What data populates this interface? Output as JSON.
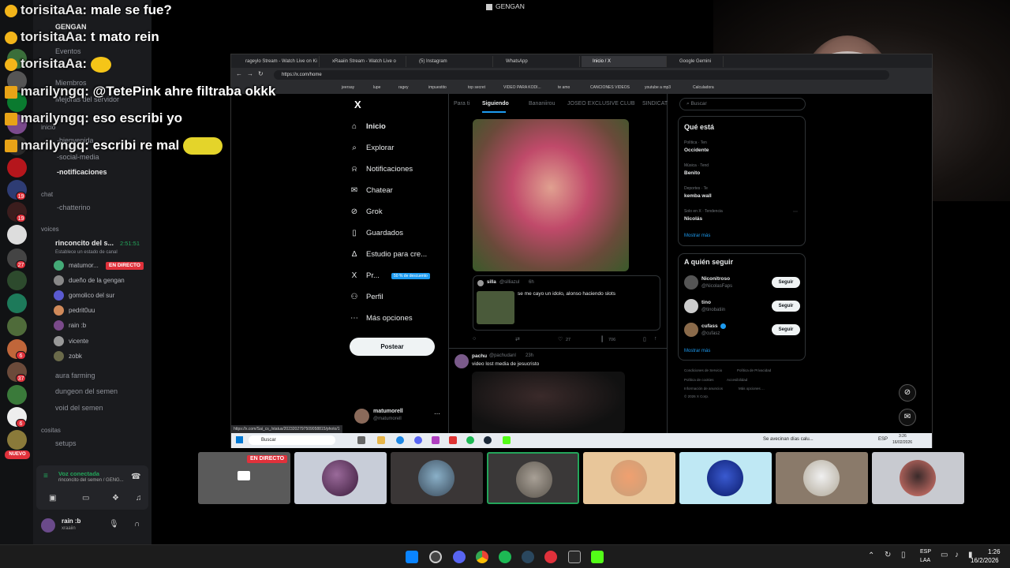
{
  "window_title": "GENGAN",
  "chat_messages": [
    {
      "user": "torisitaAa",
      "text": "male se fue?"
    },
    {
      "user": "torisitaAa",
      "text": "t mato rein"
    },
    {
      "user": "torisitaAa",
      "text": ""
    },
    {
      "user": "marilyngq",
      "text": "@TetePink ahre filtraba okkk"
    },
    {
      "user": "marilyngq",
      "text": "eso escribi yo"
    },
    {
      "user": "marilyngq",
      "text": "escribi re mal"
    }
  ],
  "discord": {
    "server_name": "GENGAN",
    "menu": [
      "Eventos",
      "Miembros",
      "Mejoras del servidor"
    ],
    "inicio_label": "inicio",
    "channels_inicio": [
      "-bienvenida",
      "-social-media",
      "-notificaciones"
    ],
    "chat_label": "chat",
    "channel_chat": "-chatterino",
    "voices_label": "voices",
    "voice_channel": {
      "name": "rinconcito del s...",
      "timer": "2:51:51",
      "status": "Establece un estado de canal"
    },
    "voice_users": [
      {
        "name": "matumor...",
        "live": "EN DIRECTO"
      },
      {
        "name": "dueño de la gengan"
      },
      {
        "name": "gomolico del sur"
      },
      {
        "name": "pedrit0uu"
      },
      {
        "name": "rain :b"
      },
      {
        "name": "vicente"
      },
      {
        "name": "zobk"
      }
    ],
    "other_voice": [
      "aura farming",
      "dungeon del semen",
      "void del semen"
    ],
    "cositas_label": "cositas",
    "setups": "setups",
    "new_badge": "NUEVO",
    "voice_connected": "Voz conectada",
    "voice_connected_sub": "rinconcito del semen / GENG...",
    "user_name": "rain :b",
    "user_sub": "xraaiin",
    "server_badges": [
      "19",
      "19",
      "27",
      "6",
      "37",
      "6"
    ]
  },
  "browser": {
    "tabs": [
      "rageylo Stream - Watch Live on Ki",
      "xRaaiin Stream - Watch Live o",
      "(5) Instagram",
      "WhatsApp",
      "Inicio / X",
      "Google Gemini"
    ],
    "url": "https://x.com/home",
    "bookmarks": [
      "",
      "jeersay",
      "lupe",
      "ragey",
      "impuestito",
      "top secret",
      "VIDEO PARA KODI...",
      "te amo",
      "CANCIONES VIDEOS",
      "youtube a mp3",
      "Calculadora"
    ],
    "status_url": "https://x.com/Sai_cs_/status/2023202797509058815/photo/1"
  },
  "x": {
    "nav": [
      {
        "icon": "home-icon",
        "label": "Inicio"
      },
      {
        "icon": "search-icon",
        "label": "Explorar"
      },
      {
        "icon": "bell-icon",
        "label": "Notificaciones"
      },
      {
        "icon": "mail-icon",
        "label": "Chatear"
      },
      {
        "icon": "grok-icon",
        "label": "Grok"
      },
      {
        "icon": "bookmark-icon",
        "label": "Guardados"
      },
      {
        "icon": "studio-icon",
        "label": "Estudio para cre..."
      },
      {
        "icon": "x-icon",
        "label": "Pr..."
      },
      {
        "icon": "person-icon",
        "label": "Perfil"
      },
      {
        "icon": "more-icon",
        "label": "Más opciones"
      }
    ],
    "premium_badge": "50 % de descuento",
    "post_button": "Postear",
    "account": {
      "name": "matumorell",
      "handle": "@matumorell"
    },
    "feed_tabs": [
      "Para ti",
      "Siguiendo",
      "Bananiirou",
      "JOSEO EXCLUSIVE CLUB",
      "SINDICAT"
    ],
    "quote": {
      "name": "silla",
      "handle": "@silliazul",
      "time": "6h",
      "text": "se me cayo un idolo, alonso haciendo slots"
    },
    "actions": {
      "likes": "27",
      "views": "706"
    },
    "post2": {
      "name": "pachu",
      "handle": "@pachudanl",
      "time": "23h",
      "text": "video lost media de jesucristo"
    },
    "search_placeholder": "Buscar",
    "trends_title": "Qué está",
    "trends": [
      {
        "cat": "Política · Ten",
        "name": "Occidente"
      },
      {
        "cat": "Música · Tend",
        "name": "Benito"
      },
      {
        "cat": "Deportes · Te",
        "name": "kemba wall"
      },
      {
        "cat": "Solo en X · Tendencia",
        "name": "Nicolás"
      }
    ],
    "show_more": "Mostrar más",
    "who_to_follow": "A quién seguir",
    "follow": [
      {
        "name": "Niconitroso",
        "handle": "@NicolasFaps"
      },
      {
        "name": "tino",
        "handle": "@tinobatiin"
      },
      {
        "name": "cufass",
        "handle": "@cufasz"
      }
    ],
    "follow_button": "Seguir",
    "footer": [
      "Condiciones de Servicio",
      "Política de Privacidad",
      "Política de cookies",
      "Accesibilidad",
      "Información de anuncios",
      "Más opciones ...",
      "© 2026 X Corp."
    ]
  },
  "win_inner": {
    "search": "Buscar",
    "weather": "Se avecinan días calu...",
    "lang": "ESP",
    "time": "3:26",
    "date": "16/02/2026"
  },
  "tiles": {
    "live": "EN DIRECTO"
  },
  "taskbar": {
    "lang": "ESP",
    "lang2": "LAA",
    "time": "1:26",
    "date": "16/2/2026"
  }
}
